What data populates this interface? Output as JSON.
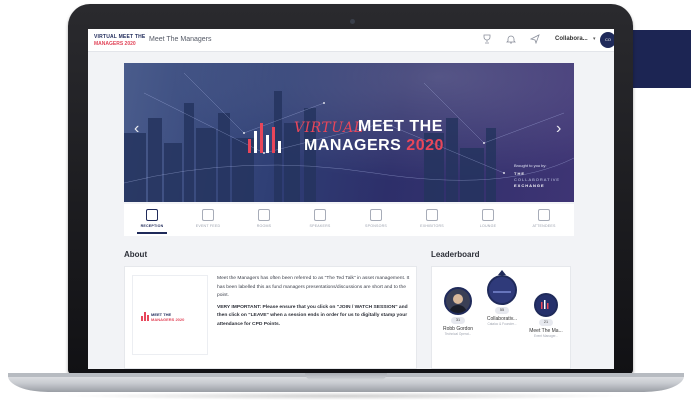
{
  "app": {
    "logo_line1": "VIRTUAL MEET THE",
    "logo_line2": "MANAGERS 2020",
    "title": "Meet The Managers"
  },
  "topbar": {
    "icons": [
      "trophy-icon",
      "bell-icon",
      "send-icon"
    ],
    "user_name": "Collabora...",
    "caret": "▾",
    "avatar_initials": "CO"
  },
  "hero": {
    "prev_arrow": "‹",
    "next_arrow": "›",
    "virtual": "VIRTUAL",
    "meet_the": "MEET THE",
    "managers": "MANAGERS",
    "year": "2020",
    "brought_by": "Brought to you by:",
    "sponsor_line1": "THE",
    "sponsor_line2": "COLLABORATIVE",
    "sponsor_line3": "EXCHANGE"
  },
  "tabs": [
    {
      "label": "RECEPTION",
      "icon": "building-icon",
      "active": true
    },
    {
      "label": "EVENT FEED",
      "icon": "chat-icon",
      "active": false
    },
    {
      "label": "ROOMS",
      "icon": "door-icon",
      "active": false
    },
    {
      "label": "SPEAKERS",
      "icon": "microphone-icon",
      "active": false
    },
    {
      "label": "SPONSORS",
      "icon": "handshake-icon",
      "active": false
    },
    {
      "label": "EXHIBITORS",
      "icon": "booth-icon",
      "active": false
    },
    {
      "label": "LOUNGE",
      "icon": "lounge-icon",
      "active": false
    },
    {
      "label": "ATTENDEES",
      "icon": "people-icon",
      "active": false
    }
  ],
  "about": {
    "heading": "About",
    "paragraph": "Meet the Managers has often been referred to as \"The Ted Talk\" in asset management. It has been labelled this as fund managers presentations/discussions are short and to the point.",
    "important": "VERY IMPORTANT: Please ensure that you click on \"JOIN / WATCH SESSION\" and then click on \"LEAVE\" when a session ends in order for us to digitally stamp your attendance for CPD Points.",
    "logo_line1": "MEET THE",
    "logo_line2": "MANAGERS 2020"
  },
  "leaderboard": {
    "heading": "Leaderboard",
    "entries": [
      {
        "rank": "31",
        "name": "Robb Gordon",
        "subtitle": "Technical Operat..."
      },
      {
        "rank": "55",
        "name": "Collaborativ...",
        "subtitle": "Cataloc & Founder..."
      },
      {
        "rank": "21",
        "name": "Meet The Ma...",
        "subtitle": "Event Manager..."
      }
    ]
  },
  "colors": {
    "brand_navy": "#1f2a5a",
    "brand_red": "#e8465a"
  }
}
